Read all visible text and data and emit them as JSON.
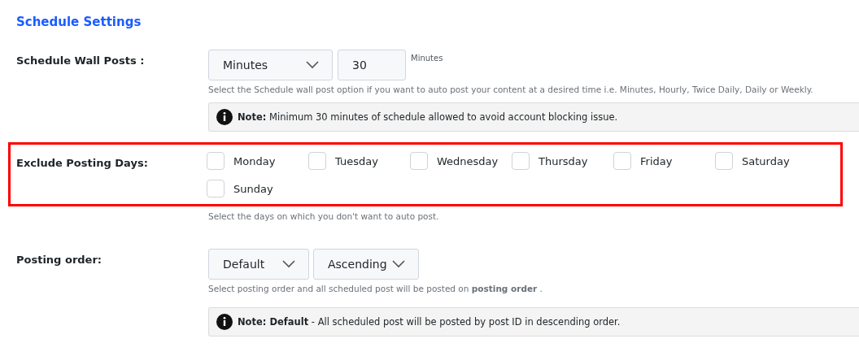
{
  "title": "Schedule Settings",
  "schedule": {
    "label": "Schedule Wall Posts :",
    "unit_select": "Minutes",
    "interval_value": "30",
    "interval_unit": "Minutes",
    "help": "Select the Schedule wall post option if you want to auto post your content at a desired time i.e. Minutes, Hourly, Twice Daily, Daily or Weekly.",
    "note": "**Note:** Minimum 30 minutes of schedule allowed to avoid account blocking issue."
  },
  "exclude_days": {
    "label": "Exclude Posting Days:",
    "highlighted": true,
    "days": [
      {
        "label": "Monday",
        "checked": false
      },
      {
        "label": "Tuesday",
        "checked": false
      },
      {
        "label": "Wednesday",
        "checked": false
      },
      {
        "label": "Thursday",
        "checked": false
      },
      {
        "label": "Friday",
        "checked": false
      },
      {
        "label": "Saturday",
        "checked": false
      },
      {
        "label": "Sunday",
        "checked": false
      }
    ],
    "help": "Select the days on which you don't want to auto post."
  },
  "posting_order": {
    "label": "Posting order:",
    "order_select": "Default",
    "direction_select": "Ascending",
    "help": "Select posting order and all scheduled post will be posted on **posting order** .",
    "note": "**Note: Default** - All scheduled post will be posted by post ID in descending order."
  }
}
